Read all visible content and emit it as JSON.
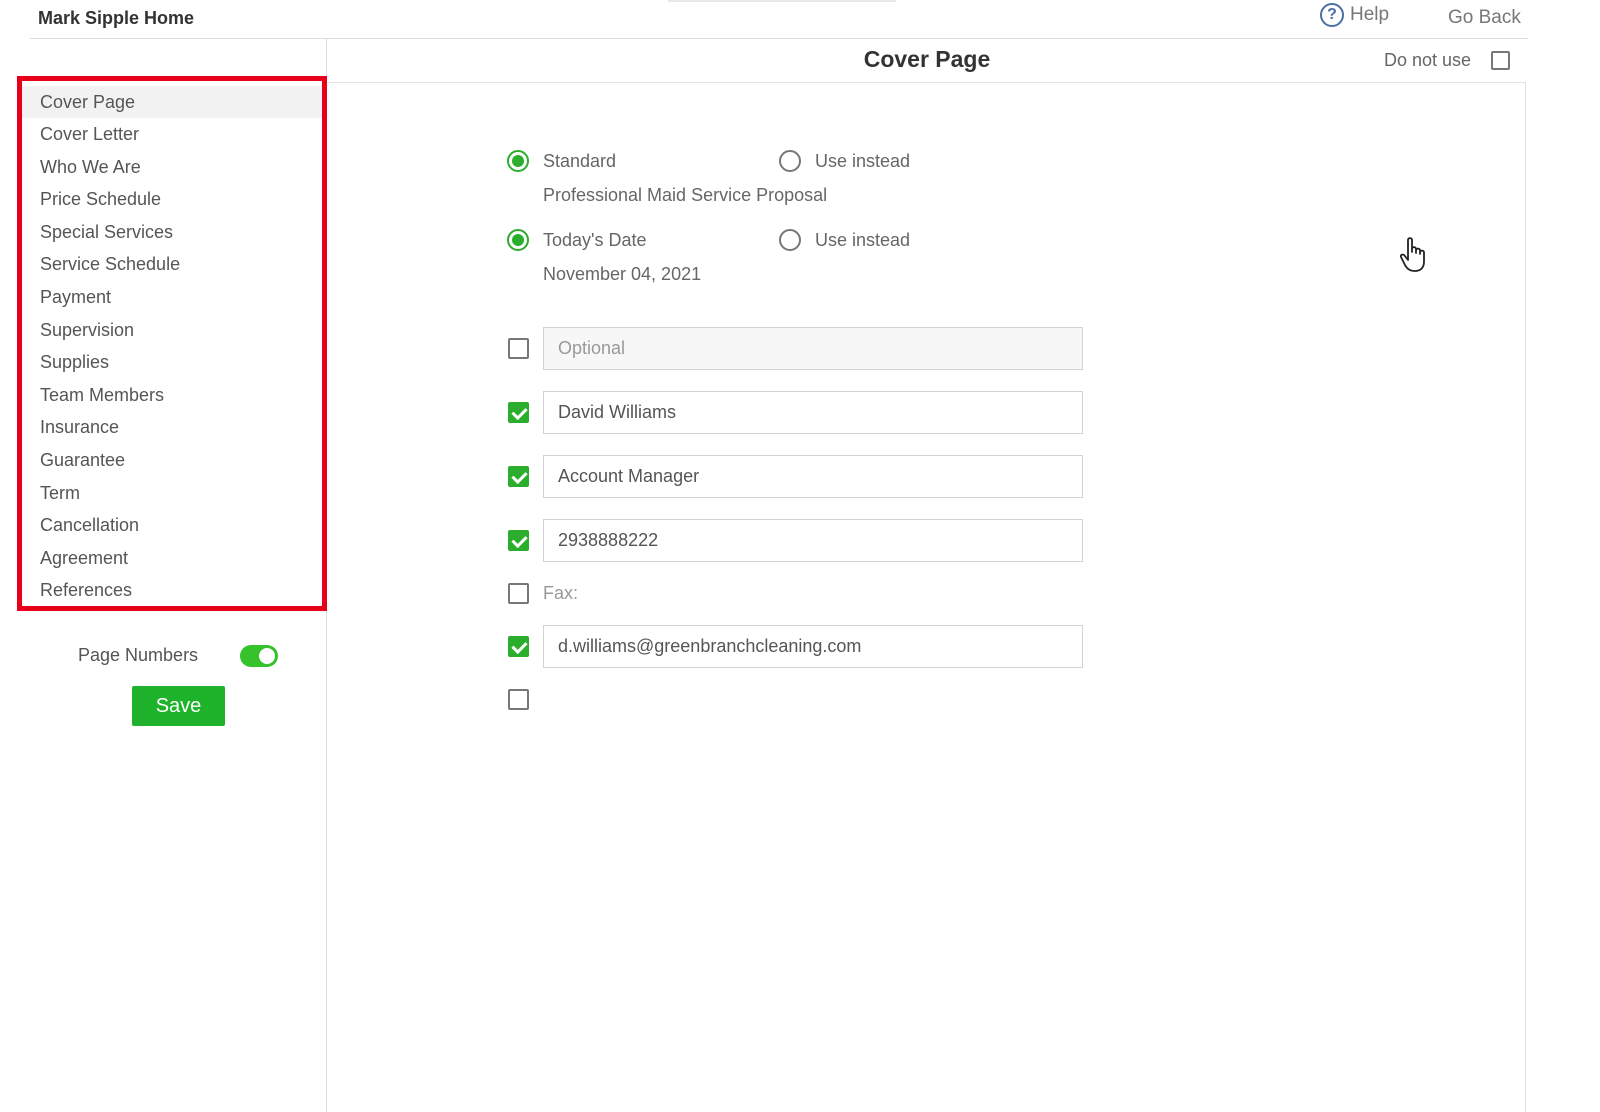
{
  "header": {
    "brand": "Mark Sipple Home",
    "help_label": "Help",
    "go_back_label": "Go Back"
  },
  "sidebar": {
    "items": [
      {
        "label": "Cover Page",
        "active": true
      },
      {
        "label": "Cover Letter"
      },
      {
        "label": "Who We Are"
      },
      {
        "label": "Price Schedule"
      },
      {
        "label": "Special Services"
      },
      {
        "label": "Service Schedule"
      },
      {
        "label": "Payment"
      },
      {
        "label": "Supervision"
      },
      {
        "label": "Supplies"
      },
      {
        "label": "Team Members"
      },
      {
        "label": "Insurance"
      },
      {
        "label": "Guarantee"
      },
      {
        "label": "Term"
      },
      {
        "label": "Cancellation"
      },
      {
        "label": "Agreement"
      },
      {
        "label": "References"
      }
    ],
    "page_numbers_label": "Page Numbers",
    "page_numbers_on": true,
    "save_label": "Save",
    "highlight_color": "#e8001b"
  },
  "main": {
    "title": "Cover Page",
    "do_not_use_label": "Do not use",
    "do_not_use_checked": false,
    "title_option": {
      "standard_label": "Standard",
      "use_instead_label": "Use instead",
      "selected": "standard",
      "value": "Professional Maid Service Proposal"
    },
    "date_option": {
      "standard_label": "Today's Date",
      "use_instead_label": "Use instead",
      "selected": "standard",
      "value": "November 04, 2021"
    },
    "fields": [
      {
        "checked": false,
        "placeholder": "Optional",
        "value": ""
      },
      {
        "checked": true,
        "value": "David Williams"
      },
      {
        "checked": true,
        "value": "Account Manager"
      },
      {
        "checked": true,
        "value": "2938888222"
      },
      {
        "checked": false,
        "label": "Fax:"
      },
      {
        "checked": true,
        "value": "d.williams@greenbranchcleaning.com"
      },
      {
        "checked": false
      }
    ]
  },
  "colors": {
    "accent_green": "#2bae2b",
    "save_green": "#1eb32a",
    "toggle_green": "#35c22b"
  }
}
